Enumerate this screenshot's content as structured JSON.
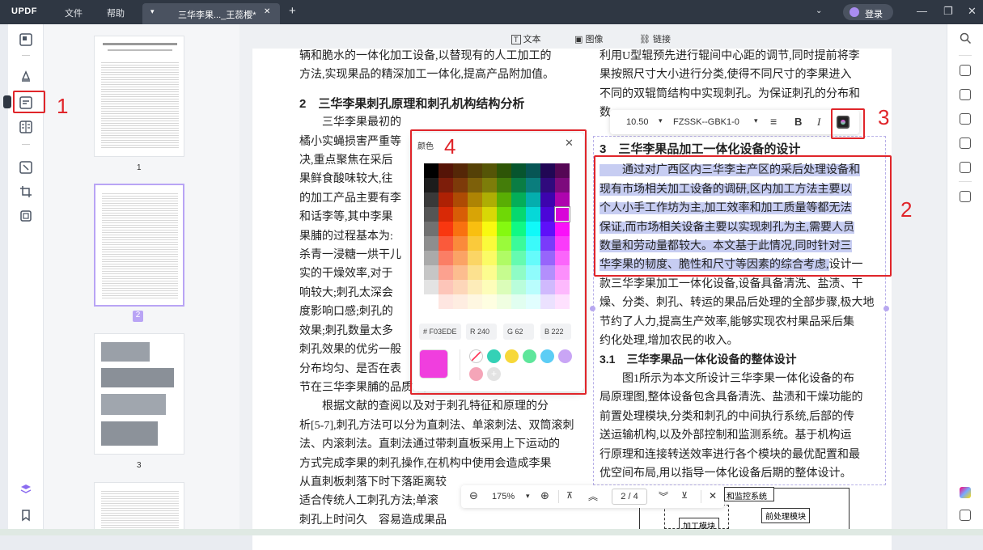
{
  "titlebar": {
    "logo": "UPDF",
    "menu_file": "文件",
    "menu_help": "帮助",
    "tab_title": "三华李果..._王蕊樱*",
    "tab_add": "+",
    "login": "登录",
    "min": "—",
    "restore": "❐",
    "close": "✕"
  },
  "toolbar": {
    "text": "文本",
    "image": "图像",
    "link": "链接"
  },
  "thumbnails": {
    "pages": [
      "1",
      "2",
      "3"
    ]
  },
  "left_column": [
    "辆和脆水的一体化加工设备,以替现有的人工加工的",
    "方法,实现果品的精深加工一体化,提高产品附加值。",
    "2　三华李果刺孔原理和刺孔机构结构分析",
    "　　三华李果最初的",
    "橘小实蝇损害严重等",
    "决,重点聚焦在采后",
    "果鲜食酸味较大,往",
    "的加工产品主要有李",
    "和话李等,其中李果",
    "果脯的过程基本为:",
    "杀青一浸糖一烘干儿",
    "实的干燥效率,对于",
    "响较大;刺孔太深会",
    "度影响口感;刺孔的",
    "效果;刺孔数量太多",
    "刺孔效果的优劣一般",
    "分布均匀、是否在表",
    "节在三华李果脯的品质中起到至关重要的作用。",
    "　　根据文献的查阅以及对于刺孔特征和原理的分",
    "析[5-7],刺孔方法可以分为直刺法、单滚刺法、双筒滚刺",
    "法、内滚刺法。直刺法通过带刺直板采用上下运动的",
    "方式完成李果的刺孔操作,在机构中使用会造成李果",
    "从直刺板刺落下时下落距离较",
    "适合传统人工刺孔方法;单滚",
    "刺孔上时问久　容易造成果品"
  ],
  "right_column": {
    "top": [
      "利用U型辊预先进行辊间中心距的调节,同时提前将李",
      "果按照尺寸大小进行分类,使得不同尺寸的李果进入",
      "不同的双辊筒结构中实现刺孔。为保证刺孔的分布和",
      "数"
    ],
    "heading3": "3　三华李果品加工一体化设备的设计",
    "selected": [
      "　　通过对广西区内三华李主产区的采后处理设备和",
      "现有市场相关加工设备的调研,区内加工方法主要以",
      "个人小手工作坊为主,加工效率和加工质量等都无法",
      "保证,而市场相关设备主要以实现刺孔为主,需要人员",
      "数量和劳动量都较大。本文基于此情况,同时针对三",
      "华李果的韧度、脆性和尺寸等因素的综合考虑,"
    ],
    "selected_tail": "设计一",
    "rest": [
      "款三华李果加工一体化设备,设备具备清洗、盐渍、干",
      "燥、分类、刺孔、转运的果品后处理的全部步骤,极大地",
      "节约了人力,提高生产效率,能够实现农村果品采后集",
      "约化处理,增加农民的收入。"
    ],
    "heading31": "3.1　三华李果品一体化设备的整体设计",
    "body31": [
      "　　图1所示为本文所设计三华李果一体化设备的布",
      "局原理图,整体设备包含具备清洗、盐渍和干燥功能的",
      "前置处理模块,分类和刺孔的中间执行系统,后部的传",
      "送运输机构,以及外部控制和监测系统。基于机构运",
      "行原理和连接转送效率进行各个模块的最优配置和最",
      "优空间布局,用以指导一体化设备后期的整体设计。"
    ],
    "figure_labels": [
      "和监控系统",
      "加工模块",
      "前处理模块"
    ]
  },
  "format_bar": {
    "size": "10.50",
    "font": "FZSSK--GBK1-0",
    "bold": "B",
    "italic": "I"
  },
  "color_picker": {
    "title": "颜色",
    "hex_label": "#",
    "hex": "F03EDE",
    "r_label": "R",
    "r": "240",
    "g_label": "G",
    "g": "62",
    "b_label": "B",
    "b": "222",
    "current_color": "#F03EDE",
    "presets": [
      "none",
      "#34d1b6",
      "#f7d83a",
      "#5ee69b",
      "#5ccdf5",
      "#c9a5f5",
      "#f5a5b8"
    ],
    "add": "+"
  },
  "annotations": [
    "1",
    "2",
    "3",
    "4"
  ],
  "bottom_bar": {
    "zoom": "175%",
    "page": "2 / 4"
  }
}
